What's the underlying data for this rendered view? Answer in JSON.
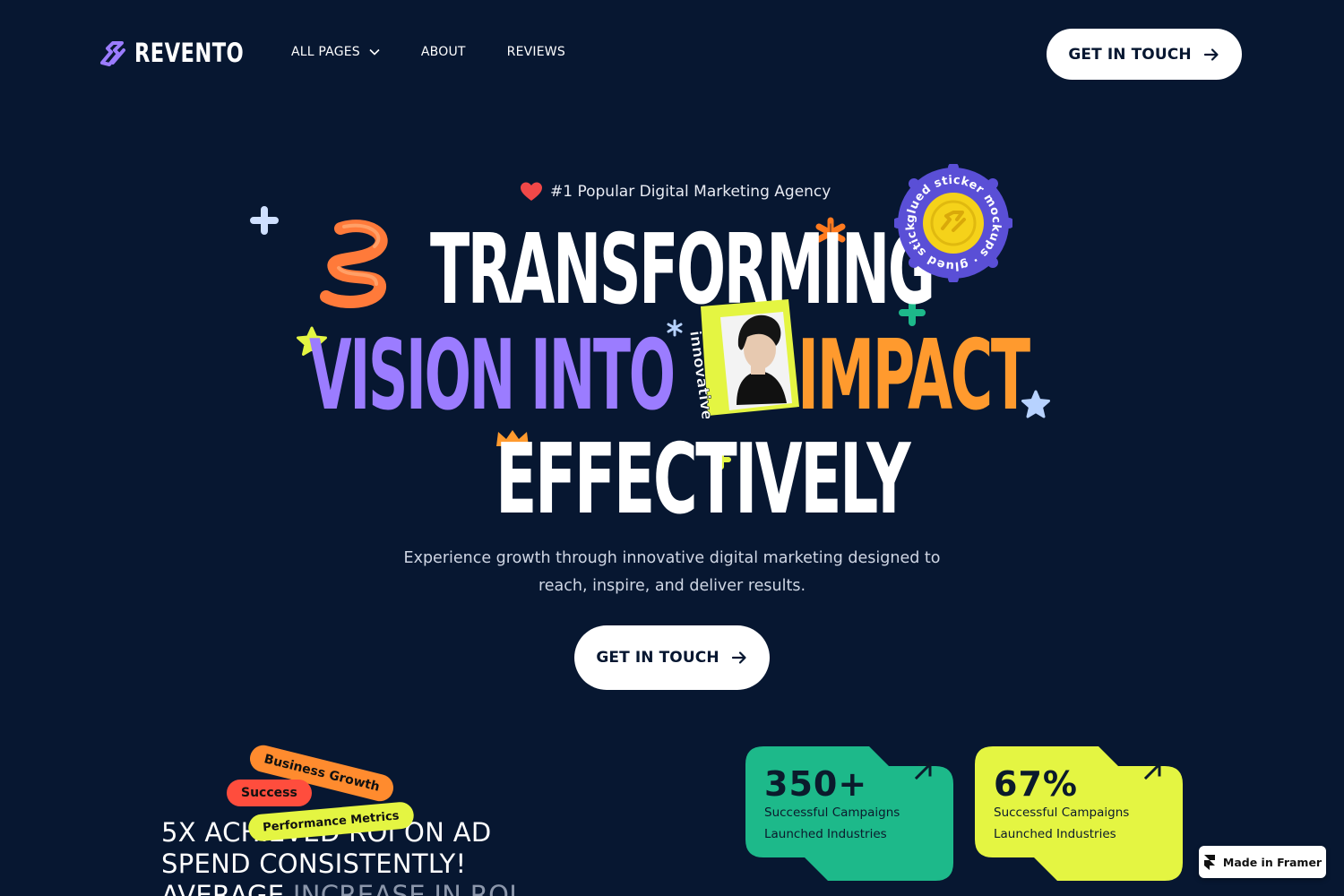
{
  "brand": {
    "name": "REVENTO",
    "accent": "#9b7cff"
  },
  "nav": {
    "links": [
      {
        "label": "ALL PAGES",
        "has_dropdown": true
      },
      {
        "label": "ABOUT"
      },
      {
        "label": "REVIEWS"
      }
    ],
    "cta_label": "GET IN TOUCH"
  },
  "hero": {
    "badge": "#1 Popular Digital Marketing Agency",
    "headline": {
      "line1": "TRANSFORMING",
      "line2a": "VISION INTO",
      "line2b": "IMPACT",
      "line3": "EFFECTIVELY"
    },
    "portrait_caption": "innovative Strategy",
    "sticker_text": "glued sticker mockups · glued sticker mockups · ",
    "subtitle": "Experience growth through innovative digital marketing designed to reach, inspire, and deliver results.",
    "cta_label": "GET IN TOUCH",
    "colors": {
      "purple": "#9b7cff",
      "orange": "#ff9a2e",
      "background": "#071731"
    }
  },
  "tags": [
    "Business Growth",
    "Success",
    "Performance Metrics"
  ],
  "roi": {
    "lead": "5X ACHIEVED ROI ON AD SPEND CONSISTENTLY! AVERAGE",
    "tail": "INCREASE IN ROI"
  },
  "stats": [
    {
      "value": "350+",
      "line1": "Successful Campaigns",
      "line2": "Launched Industries",
      "color": "#1db98a"
    },
    {
      "value": "67%",
      "line1": "Successful Campaigns",
      "line2": "Launched Industries",
      "color": "#e4f542"
    }
  ],
  "framer_badge": "Made in Framer"
}
